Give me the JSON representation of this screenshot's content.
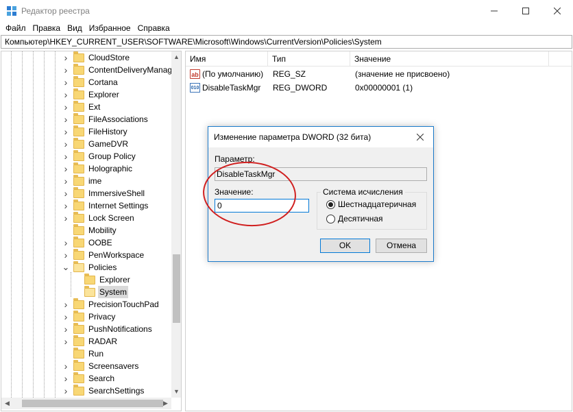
{
  "window": {
    "title": "Редактор реестра"
  },
  "menu": [
    "Файл",
    "Правка",
    "Вид",
    "Избранное",
    "Справка"
  ],
  "address": "Компьютер\\HKEY_CURRENT_USER\\SOFTWARE\\Microsoft\\Windows\\CurrentVersion\\Policies\\System",
  "tree": {
    "items": [
      {
        "label": "CloudStore",
        "expand": "collapsed"
      },
      {
        "label": "ContentDeliveryManage",
        "expand": "collapsed"
      },
      {
        "label": "Cortana",
        "expand": "collapsed"
      },
      {
        "label": "Explorer",
        "expand": "collapsed"
      },
      {
        "label": "Ext",
        "expand": "collapsed"
      },
      {
        "label": "FileAssociations",
        "expand": "collapsed"
      },
      {
        "label": "FileHistory",
        "expand": "collapsed"
      },
      {
        "label": "GameDVR",
        "expand": "collapsed"
      },
      {
        "label": "Group Policy",
        "expand": "collapsed"
      },
      {
        "label": "Holographic",
        "expand": "collapsed"
      },
      {
        "label": "ime",
        "expand": "collapsed"
      },
      {
        "label": "ImmersiveShell",
        "expand": "collapsed"
      },
      {
        "label": "Internet Settings",
        "expand": "collapsed"
      },
      {
        "label": "Lock Screen",
        "expand": "collapsed"
      },
      {
        "label": "Mobility",
        "expand": "none"
      },
      {
        "label": "OOBE",
        "expand": "collapsed"
      },
      {
        "label": "PenWorkspace",
        "expand": "collapsed"
      },
      {
        "label": "Policies",
        "expand": "expanded"
      },
      {
        "label": "Explorer",
        "expand": "none",
        "child": true
      },
      {
        "label": "System",
        "expand": "none",
        "child": true,
        "selected": true
      },
      {
        "label": "PrecisionTouchPad",
        "expand": "collapsed"
      },
      {
        "label": "Privacy",
        "expand": "collapsed"
      },
      {
        "label": "PushNotifications",
        "expand": "collapsed"
      },
      {
        "label": "RADAR",
        "expand": "collapsed"
      },
      {
        "label": "Run",
        "expand": "none"
      },
      {
        "label": "Screensavers",
        "expand": "collapsed"
      },
      {
        "label": "Search",
        "expand": "collapsed"
      },
      {
        "label": "SearchSettings",
        "expand": "collapsed"
      }
    ]
  },
  "list": {
    "columns": [
      "Имя",
      "Тип",
      "Значение"
    ],
    "rows": [
      {
        "icon": "string-value-icon",
        "name": "(По умолчанию)",
        "type": "REG_SZ",
        "value": "(значение не присвоено)"
      },
      {
        "icon": "dword-value-icon",
        "name": "DisableTaskMgr",
        "type": "REG_DWORD",
        "value": "0x00000001 (1)"
      }
    ]
  },
  "dialog": {
    "title": "Изменение параметра DWORD (32 бита)",
    "param_label": "Параметр:",
    "param_value": "DisableTaskMgr",
    "value_label": "Значение:",
    "value_input": "0",
    "base_group": "Система исчисления",
    "radio_hex": "Шестнадцатеричная",
    "radio_dec": "Десятичная",
    "selected_base": "hex",
    "ok": "OK",
    "cancel": "Отмена"
  },
  "colors": {
    "annotation": "#d01f1f",
    "accent": "#0078d7"
  }
}
